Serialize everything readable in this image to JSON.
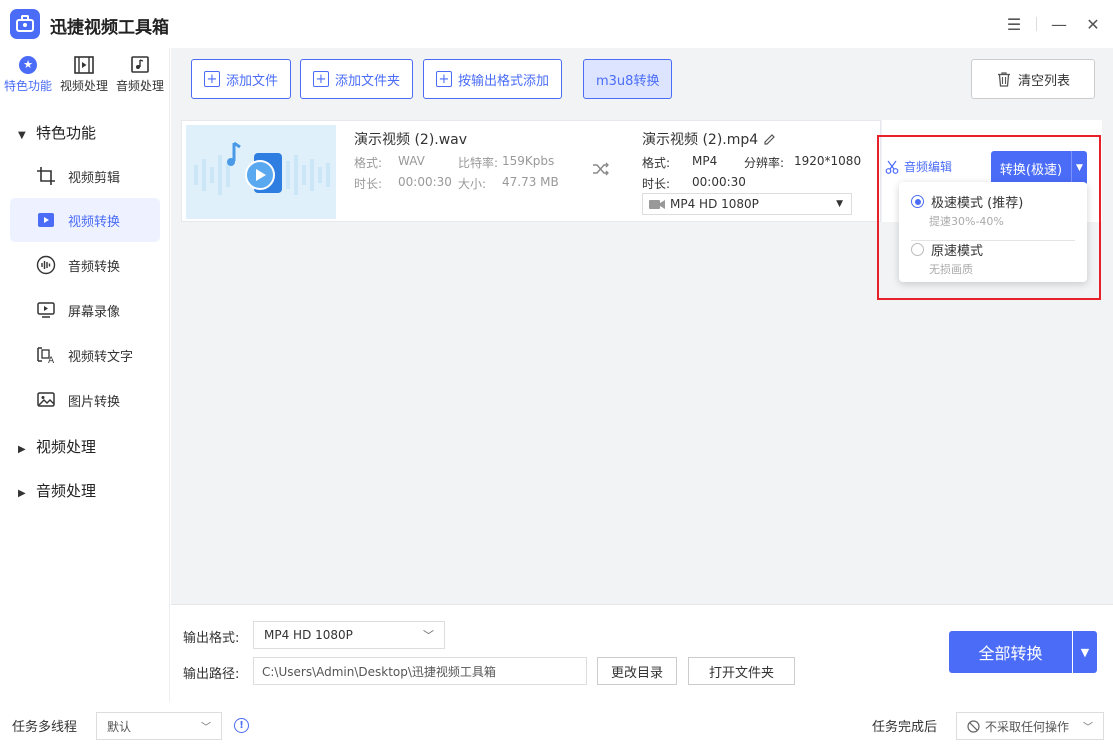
{
  "app": {
    "title": "迅捷视频工具箱"
  },
  "window": {
    "menu_icon": "menu-icon",
    "minimize_icon": "minimize-icon",
    "close_icon": "close-icon"
  },
  "sidebar": {
    "top_tabs": [
      {
        "label": "特色功能",
        "icon": "star-icon",
        "active": true
      },
      {
        "label": "视频处理",
        "icon": "film-icon",
        "active": false
      },
      {
        "label": "音频处理",
        "icon": "music-icon",
        "active": false
      }
    ],
    "section_featured": "特色功能",
    "items": [
      {
        "label": "视频剪辑",
        "icon": "video-crop-icon"
      },
      {
        "label": "视频转换",
        "icon": "video-convert-icon",
        "active": true
      },
      {
        "label": "音频转换",
        "icon": "audio-wave-icon"
      },
      {
        "label": "屏幕录像",
        "icon": "screen-record-icon"
      },
      {
        "label": "视频转文字",
        "icon": "video-to-text-icon"
      },
      {
        "label": "图片转换",
        "icon": "image-icon"
      }
    ],
    "section_video": "视频处理",
    "section_audio": "音频处理"
  },
  "toolbar": {
    "add_file": "添加文件",
    "add_folder": "添加文件夹",
    "add_by_format": "按输出格式添加",
    "m3u8": "m3u8转换",
    "clear_list": "清空列表"
  },
  "file": {
    "source_name": "演示视频 (2).wav",
    "src_format_label": "格式:",
    "src_format": "WAV",
    "src_bitrate_label": "比特率:",
    "src_bitrate": "159Kpbs",
    "src_duration_label": "时长:",
    "src_duration": "00:00:30",
    "src_size_label": "大小:",
    "src_size": "47.73 MB",
    "target_name": "演示视频 (2).mp4",
    "tgt_format_label": "格式:",
    "tgt_format": "MP4",
    "tgt_resolution_label": "分辨率:",
    "tgt_resolution": "1920*1080",
    "tgt_duration_label": "时长:",
    "tgt_duration": "00:00:30",
    "tgt_preset": "MP4   HD 1080P",
    "audio_edit": "音频编辑",
    "convert_btn": "转换(极速)"
  },
  "mode_menu": {
    "fast_label": "极速模式 (推荐)",
    "fast_sub": "提速30%-40%",
    "normal_label": "原速模式",
    "normal_sub": "无损画质",
    "selected": "fast"
  },
  "output": {
    "format_label": "输出格式:",
    "format_value": "MP4   HD 1080P",
    "path_label": "输出路径:",
    "path_value": "C:\\Users\\Admin\\Desktop\\迅捷视频工具箱",
    "change_dir": "更改目录",
    "open_folder": "打开文件夹",
    "convert_all": "全部转换"
  },
  "status": {
    "multithread_label": "任务多线程",
    "multithread_value": "默认",
    "after_label": "任务完成后",
    "after_value": "不采取任何操作"
  },
  "colors": {
    "accent": "#4a6cf7",
    "highlight_frame": "#e8202a"
  }
}
